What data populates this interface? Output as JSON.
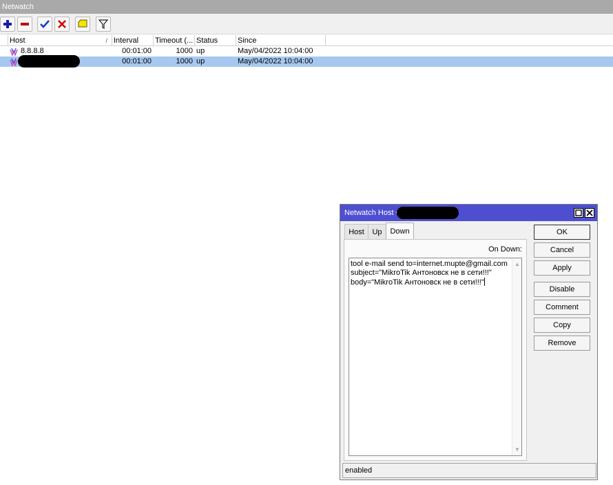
{
  "window": {
    "title": "Netwatch"
  },
  "toolbar": {
    "add": "add-icon",
    "remove": "remove-icon",
    "enable": "check-icon",
    "disable": "cross-icon",
    "comment": "comment-icon",
    "filter": "filter-icon"
  },
  "table": {
    "columns": [
      "Host",
      "Interval",
      "Timeout (...",
      "Status",
      "Since"
    ],
    "sort_indicator": "/",
    "rows": [
      {
        "host": "8.8.8.8",
        "interval": "00:01:00",
        "timeout": "1000",
        "status": "up",
        "since": "May/04/2022 10:04:00",
        "selected": false
      },
      {
        "host": "",
        "interval": "00:01:00",
        "timeout": "1000",
        "status": "up",
        "since": "May/04/2022 10:04:00",
        "selected": true
      }
    ]
  },
  "dialog": {
    "title": "Netwatch Host <",
    "tabs": [
      "Host",
      "Up",
      "Down"
    ],
    "active_tab": "Down",
    "section_label": "On Down:",
    "script": "tool e-mail send to=internet.mupte@gmail.com\nsubject=\"MikroTik Антоновск не в сети!!!\"\nbody=\"MikroTik Антоновск не в сети!!!\"",
    "buttons": {
      "ok": "OK",
      "cancel": "Cancel",
      "apply": "Apply",
      "disable": "Disable",
      "comment": "Comment",
      "copy": "Copy",
      "remove": "Remove"
    },
    "status": "enabled"
  },
  "colors": {
    "titlebar": "#a9a9a9",
    "dialog_titlebar": "#4e4fd0",
    "selection": "#a6c8f0"
  }
}
